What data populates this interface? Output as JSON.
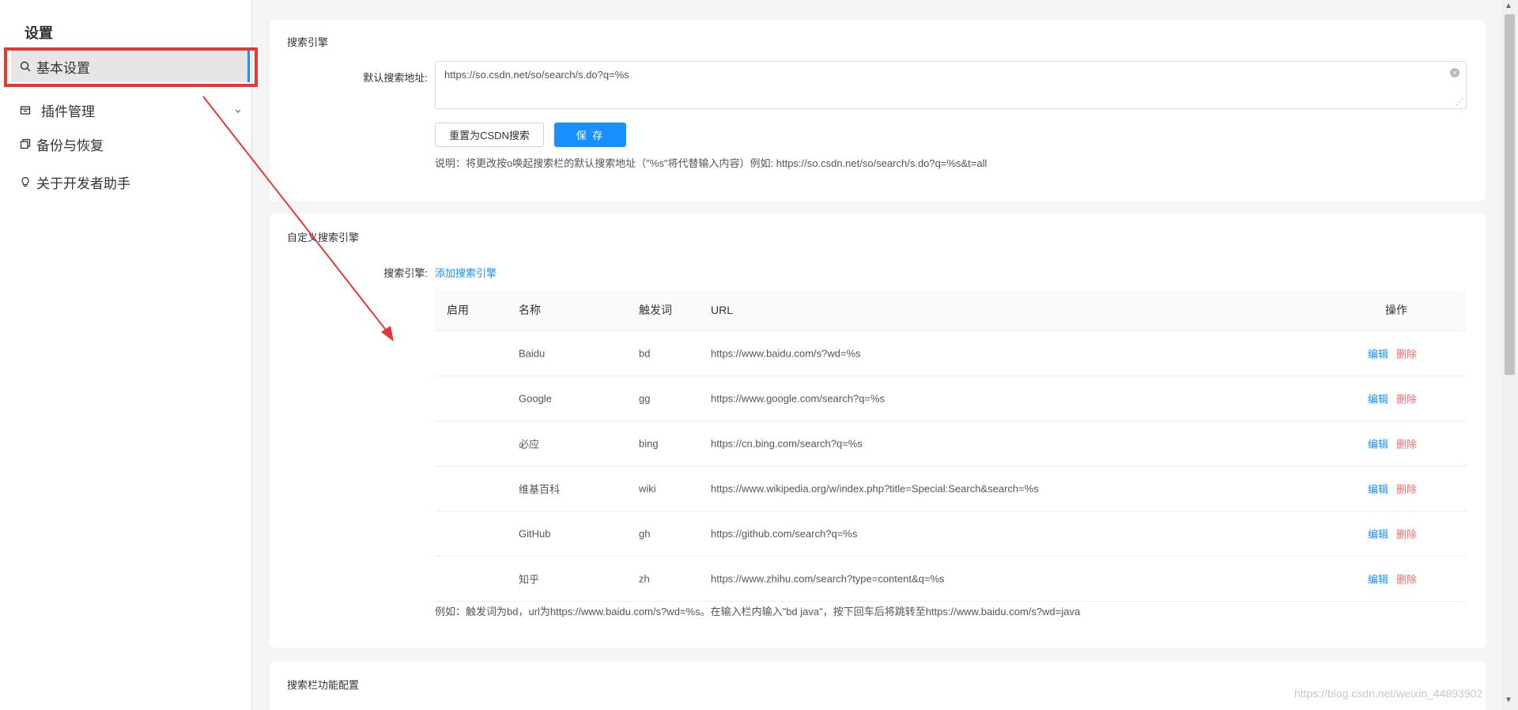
{
  "sidebar": {
    "title": "设置",
    "items": [
      {
        "label": "基本设置",
        "icon": "search-icon"
      },
      {
        "label": "插件管理",
        "icon": "box-icon"
      },
      {
        "label": "备份与恢复",
        "icon": "copy-icon"
      },
      {
        "label": "关于开发者助手",
        "icon": "bulb-icon"
      }
    ]
  },
  "search_engine": {
    "title": "搜索引擎",
    "label": "默认搜索地址:",
    "value": "https://so.csdn.net/so/search/s.do?q=%s",
    "reset_label": "重置为CSDN搜索",
    "save_label": "保 存",
    "note": "说明：将更改按o唤起搜索栏的默认搜索地址（\"%s\"将代替输入内容）例如: https://so.csdn.net/so/search/s.do?q=%s&t=all"
  },
  "custom_engine": {
    "title": "自定义搜索引擎",
    "label": "搜索引擎:",
    "add_label": "添加搜索引擎",
    "columns": [
      "启用",
      "名称",
      "触发词",
      "URL",
      "操作"
    ],
    "rows": [
      {
        "enabled": true,
        "name": "Baidu",
        "trigger": "bd",
        "url": "https://www.baidu.com/s?wd=%s",
        "edit": "编辑",
        "delete": "删除"
      },
      {
        "enabled": true,
        "name": "Google",
        "trigger": "gg",
        "url": "https://www.google.com/search?q=%s",
        "edit": "编辑",
        "delete": "删除"
      },
      {
        "enabled": true,
        "name": "必应",
        "trigger": "bing",
        "url": "https://cn.bing.com/search?q=%s",
        "edit": "编辑",
        "delete": "删除"
      },
      {
        "enabled": true,
        "name": "维基百科",
        "trigger": "wiki",
        "url": "https://www.wikipedia.org/w/index.php?title=Special:Search&search=%s",
        "edit": "编辑",
        "delete": "删除"
      },
      {
        "enabled": true,
        "name": "GitHub",
        "trigger": "gh",
        "url": "https://github.com/search?q=%s",
        "edit": "编辑",
        "delete": "删除"
      },
      {
        "enabled": true,
        "name": "知乎",
        "trigger": "zh",
        "url": "https://www.zhihu.com/search?type=content&q=%s",
        "edit": "编辑",
        "delete": "删除"
      }
    ],
    "example": "例如：触发词为bd，url为https://www.baidu.com/s?wd=%s。在输入栏内输入\"bd java\"，按下回车后将跳转至https://www.baidu.com/s?wd=java"
  },
  "searchbar_config": {
    "title": "搜索栏功能配置"
  },
  "watermark": "https://blog.csdn.net/weixin_44893902",
  "colors": {
    "accent": "#1890ff",
    "danger": "#f56c6c",
    "annotation": "#e53935"
  }
}
